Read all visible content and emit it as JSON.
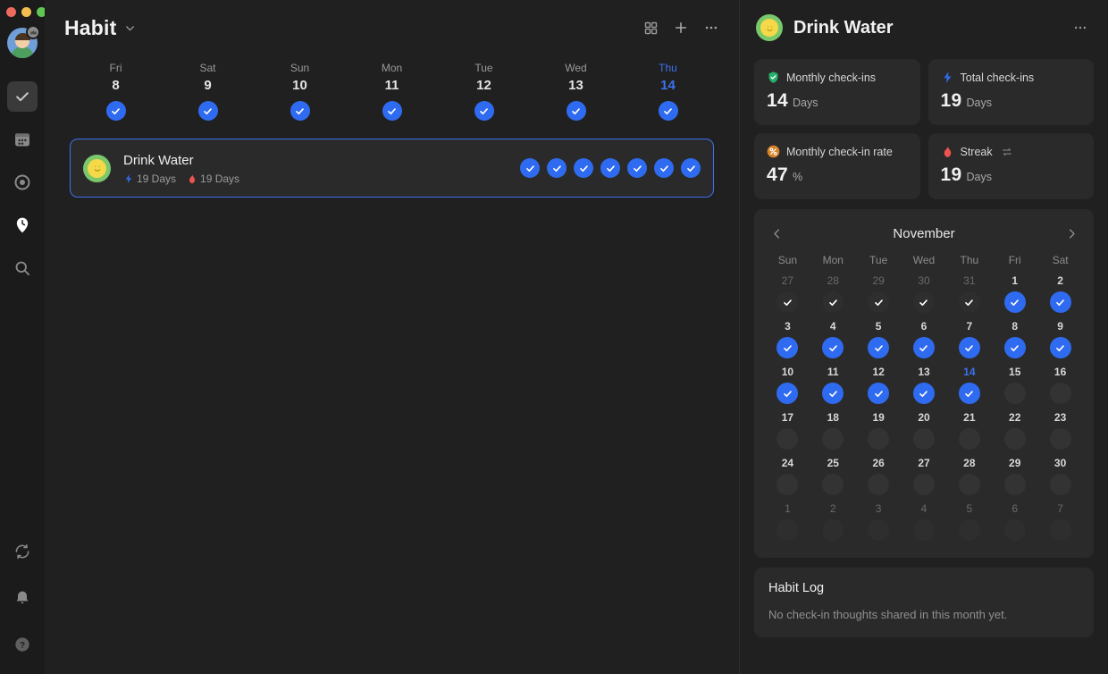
{
  "window": {
    "traffic_lights": [
      "close",
      "minimize",
      "maximize"
    ]
  },
  "sidebar": {
    "avatar": {
      "name": "user-avatar",
      "badge_icon": "crown-icon"
    },
    "items": [
      {
        "label": "Tasks",
        "icon": "check-square-icon",
        "active": true
      },
      {
        "label": "Calendar",
        "icon": "calendar-icon",
        "active": false
      },
      {
        "label": "Goals",
        "icon": "target-icon",
        "active": false
      },
      {
        "label": "Habit",
        "icon": "clock-pin-icon",
        "active": true
      },
      {
        "label": "Search",
        "icon": "search-icon",
        "active": false
      }
    ],
    "bottom_items": [
      {
        "label": "Sync",
        "icon": "sync-icon"
      },
      {
        "label": "Notifications",
        "icon": "bell-icon"
      },
      {
        "label": "Help",
        "icon": "help-icon"
      }
    ]
  },
  "header": {
    "title": "Habit",
    "chevron_icon": "chevron-down-icon",
    "actions": [
      {
        "label": "Grid view",
        "icon": "grid-icon"
      },
      {
        "label": "Add habit",
        "icon": "plus-icon"
      },
      {
        "label": "More options",
        "icon": "more-horizontal-icon"
      }
    ]
  },
  "week_strip": [
    {
      "dow": "Fri",
      "day": "8",
      "checked": true,
      "today": false
    },
    {
      "dow": "Sat",
      "day": "9",
      "checked": true,
      "today": false
    },
    {
      "dow": "Sun",
      "day": "10",
      "checked": true,
      "today": false
    },
    {
      "dow": "Mon",
      "day": "11",
      "checked": true,
      "today": false
    },
    {
      "dow": "Tue",
      "day": "12",
      "checked": true,
      "today": false
    },
    {
      "dow": "Wed",
      "day": "13",
      "checked": true,
      "today": false
    },
    {
      "dow": "Thu",
      "day": "14",
      "checked": true,
      "today": true
    }
  ],
  "habits": [
    {
      "name": "Drink Water",
      "emoji": "smiley-face",
      "total_label": "19 Days",
      "total_icon": "lightning-icon",
      "streak_label": "19 Days",
      "streak_icon": "flame-icon",
      "selected": true,
      "checks": [
        true,
        true,
        true,
        true,
        true,
        true,
        true
      ]
    }
  ],
  "panel": {
    "title": "Drink Water",
    "emoji": "smiley-face",
    "more_icon": "more-horizontal-icon",
    "stats": [
      {
        "label": "Monthly check-ins",
        "value": "14",
        "unit": "Days",
        "icon": "shield-check-icon",
        "icon_color": "#27b06b"
      },
      {
        "label": "Total check-ins",
        "value": "19",
        "unit": "Days",
        "icon": "lightning-icon",
        "icon_color": "#2f6bf0"
      },
      {
        "label": "Monthly check-in rate",
        "value": "47",
        "unit": "%",
        "icon": "percent-icon",
        "icon_color": "#d58227"
      },
      {
        "label": "Streak",
        "value": "19",
        "unit": "Days",
        "icon": "flame-icon",
        "icon_color": "#ef5350",
        "extra_icon": "swap-icon"
      }
    ],
    "calendar": {
      "month": "November",
      "prev_icon": "chevron-left-icon",
      "next_icon": "chevron-right-icon",
      "dow_labels": [
        "Sun",
        "Mon",
        "Tue",
        "Wed",
        "Thu",
        "Fri",
        "Sat"
      ],
      "cells": [
        {
          "day": "27",
          "in_month": false,
          "checked": true,
          "today": false
        },
        {
          "day": "28",
          "in_month": false,
          "checked": true,
          "today": false
        },
        {
          "day": "29",
          "in_month": false,
          "checked": true,
          "today": false
        },
        {
          "day": "30",
          "in_month": false,
          "checked": true,
          "today": false
        },
        {
          "day": "31",
          "in_month": false,
          "checked": true,
          "today": false
        },
        {
          "day": "1",
          "in_month": true,
          "checked": true,
          "today": false
        },
        {
          "day": "2",
          "in_month": true,
          "checked": true,
          "today": false
        },
        {
          "day": "3",
          "in_month": true,
          "checked": true,
          "today": false
        },
        {
          "day": "4",
          "in_month": true,
          "checked": true,
          "today": false
        },
        {
          "day": "5",
          "in_month": true,
          "checked": true,
          "today": false
        },
        {
          "day": "6",
          "in_month": true,
          "checked": true,
          "today": false
        },
        {
          "day": "7",
          "in_month": true,
          "checked": true,
          "today": false
        },
        {
          "day": "8",
          "in_month": true,
          "checked": true,
          "today": false
        },
        {
          "day": "9",
          "in_month": true,
          "checked": true,
          "today": false
        },
        {
          "day": "10",
          "in_month": true,
          "checked": true,
          "today": false
        },
        {
          "day": "11",
          "in_month": true,
          "checked": true,
          "today": false
        },
        {
          "day": "12",
          "in_month": true,
          "checked": true,
          "today": false
        },
        {
          "day": "13",
          "in_month": true,
          "checked": true,
          "today": false
        },
        {
          "day": "14",
          "in_month": true,
          "checked": true,
          "today": true
        },
        {
          "day": "15",
          "in_month": true,
          "checked": false,
          "today": false
        },
        {
          "day": "16",
          "in_month": true,
          "checked": false,
          "today": false
        },
        {
          "day": "17",
          "in_month": true,
          "checked": false,
          "today": false
        },
        {
          "day": "18",
          "in_month": true,
          "checked": false,
          "today": false
        },
        {
          "day": "19",
          "in_month": true,
          "checked": false,
          "today": false
        },
        {
          "day": "20",
          "in_month": true,
          "checked": false,
          "today": false
        },
        {
          "day": "21",
          "in_month": true,
          "checked": false,
          "today": false
        },
        {
          "day": "22",
          "in_month": true,
          "checked": false,
          "today": false
        },
        {
          "day": "23",
          "in_month": true,
          "checked": false,
          "today": false
        },
        {
          "day": "24",
          "in_month": true,
          "checked": false,
          "today": false
        },
        {
          "day": "25",
          "in_month": true,
          "checked": false,
          "today": false
        },
        {
          "day": "26",
          "in_month": true,
          "checked": false,
          "today": false
        },
        {
          "day": "27",
          "in_month": true,
          "checked": false,
          "today": false
        },
        {
          "day": "28",
          "in_month": true,
          "checked": false,
          "today": false
        },
        {
          "day": "29",
          "in_month": true,
          "checked": false,
          "today": false
        },
        {
          "day": "30",
          "in_month": true,
          "checked": false,
          "today": false
        },
        {
          "day": "1",
          "in_month": false,
          "checked": false,
          "today": false
        },
        {
          "day": "2",
          "in_month": false,
          "checked": false,
          "today": false
        },
        {
          "day": "3",
          "in_month": false,
          "checked": false,
          "today": false
        },
        {
          "day": "4",
          "in_month": false,
          "checked": false,
          "today": false
        },
        {
          "day": "5",
          "in_month": false,
          "checked": false,
          "today": false
        },
        {
          "day": "6",
          "in_month": false,
          "checked": false,
          "today": false
        },
        {
          "day": "7",
          "in_month": false,
          "checked": false,
          "today": false
        }
      ]
    },
    "habit_log": {
      "title": "Habit Log",
      "empty_text": "No check-in thoughts shared in this month yet."
    }
  },
  "colors": {
    "accent_blue": "#2f6bf0",
    "today_blue": "#3b72f0",
    "bg": "#202020",
    "card": "#2a2a2a",
    "sidebar": "#1b1b1b"
  }
}
